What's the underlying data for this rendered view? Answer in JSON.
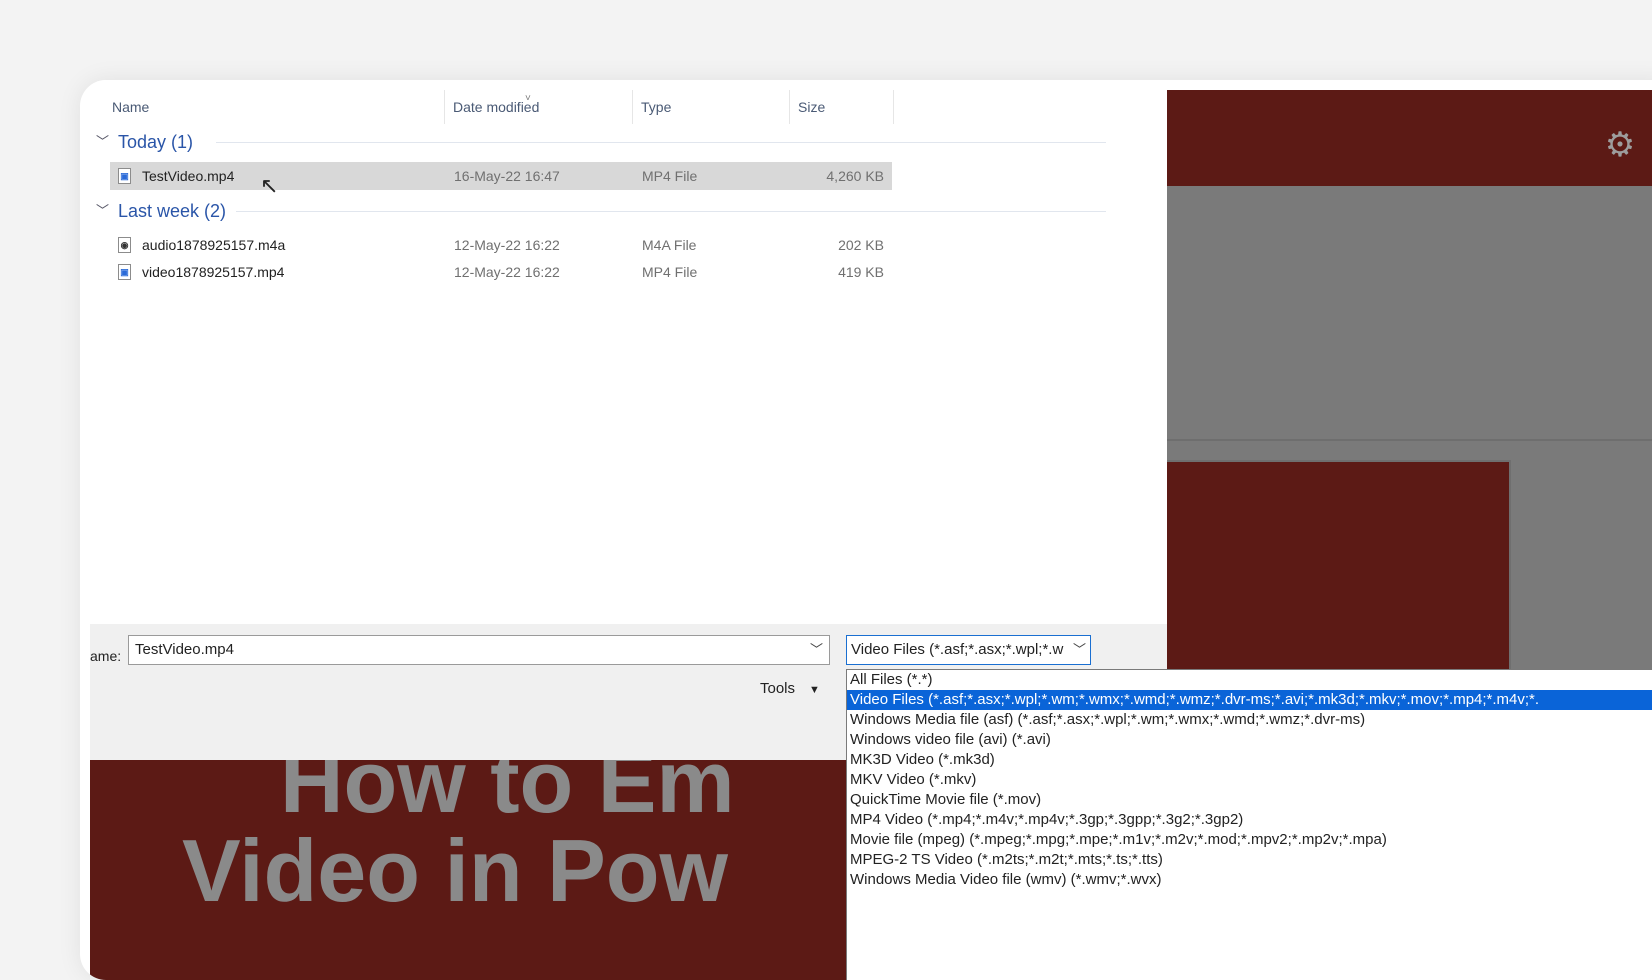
{
  "columns": {
    "name": "Name",
    "date": "Date modified",
    "type": "Type",
    "size": "Size"
  },
  "groups": {
    "today": "Today (1)",
    "last_week": "Last week (2)"
  },
  "files": [
    {
      "name": "TestVideo.mp4",
      "date": "16-May-22 16:47",
      "type": "MP4 File",
      "size": "4,260 KB",
      "icon": "video-file-icon"
    },
    {
      "name": "audio1878925157.m4a",
      "date": "12-May-22 16:22",
      "type": "M4A File",
      "size": "202 KB",
      "icon": "audio-file-icon"
    },
    {
      "name": "video1878925157.mp4",
      "date": "12-May-22 16:22",
      "type": "MP4 File",
      "size": "419 KB",
      "icon": "video-file-icon"
    }
  ],
  "filename": {
    "label": "ame:",
    "value": "TestVideo.mp4"
  },
  "filter": {
    "selected": "Video Files (*.asf;*.asx;*.wpl;*.w"
  },
  "tools_label": "Tools",
  "dropdown_options": [
    "All Files (*.*)",
    "Video Files (*.asf;*.asx;*.wpl;*.wm;*.wmx;*.wmd;*.wmz;*.dvr-ms;*.avi;*.mk3d;*.mkv;*.mov;*.mp4;*.m4v;*.",
    "Windows Media file (asf) (*.asf;*.asx;*.wpl;*.wm;*.wmx;*.wmd;*.wmz;*.dvr-ms)",
    "Windows video file (avi) (*.avi)",
    "MK3D Video (*.mk3d)",
    "MKV Video (*.mkv)",
    "QuickTime Movie file (*.mov)",
    "MP4 Video (*.mp4;*.m4v;*.mp4v;*.3gp;*.3gpp;*.3g2;*.3gp2)",
    "Movie file (mpeg) (*.mpeg;*.mpg;*.mpe;*.m1v;*.m2v;*.mod;*.mpv2;*.mp2v;*.mpa)",
    "MPEG-2 TS Video (*.m2ts;*.m2t;*.mts;*.ts;*.tts)",
    "Windows Media Video file (wmv) (*.wmv;*.wvx)"
  ],
  "background_slide": {
    "title_line1": "How to Em",
    "title_line2": "Video in Pow"
  },
  "colors": {
    "slide_red": "#5c1a15",
    "selection_blue": "#0a64d8",
    "group_title_blue": "#2a55a8"
  }
}
